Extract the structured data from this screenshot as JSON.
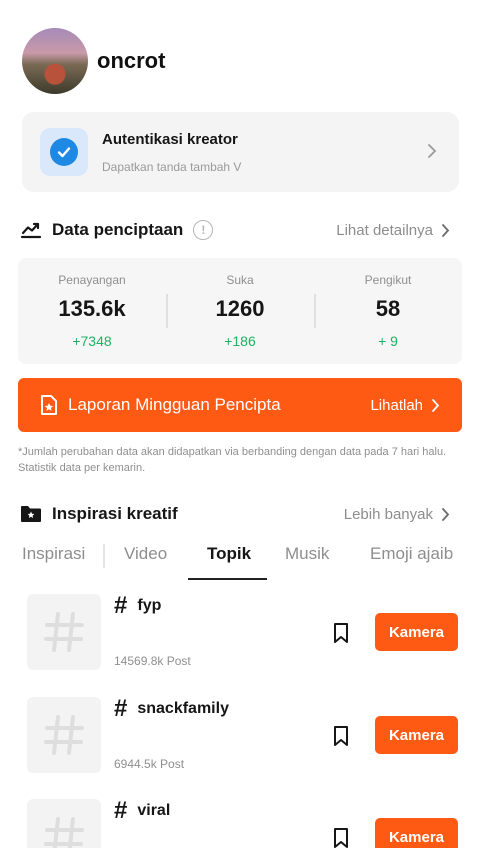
{
  "profile": {
    "username": "oncrot"
  },
  "auth": {
    "title": "Autentikasi kreator",
    "subtitle": "Dapatkan tanda tambah V"
  },
  "data_section": {
    "title": "Data penciptaan",
    "info": "!",
    "link": "Lihat detailnya"
  },
  "stats": [
    {
      "label": "Penayangan",
      "value": "135.6k",
      "delta": "+7348"
    },
    {
      "label": "Suka",
      "value": "1260",
      "delta": "+186"
    },
    {
      "label": "Pengikut",
      "value": "58",
      "delta": "+ 9"
    }
  ],
  "report": {
    "label": "Laporan Mingguan Pencipta",
    "action": "Lihatlah"
  },
  "footnote": "*Jumlah perubahan data akan didapatkan via berbanding dengan data pada 7 hari halu. Statistik data per kemarin.",
  "inspiration": {
    "title": "Inspirasi kreatif",
    "link": "Lebih banyak"
  },
  "tabs": [
    {
      "label": "Inspirasi"
    },
    {
      "label": "Video"
    },
    {
      "label": "Topik"
    },
    {
      "label": "Musik"
    },
    {
      "label": "Emoji ajaib"
    }
  ],
  "active_tab": "Topik",
  "topics": [
    {
      "name": "fyp",
      "count": "14569.8k Post",
      "button": "Kamera"
    },
    {
      "name": "snackfamily",
      "count": "6944.5k Post",
      "button": "Kamera"
    },
    {
      "name": "viral",
      "count": "",
      "button": "Kamera"
    }
  ],
  "hash_symbol": "#",
  "colors": {
    "accent": "#ff5a14",
    "positive": "#1fb162",
    "verified": "#1e88e5"
  }
}
